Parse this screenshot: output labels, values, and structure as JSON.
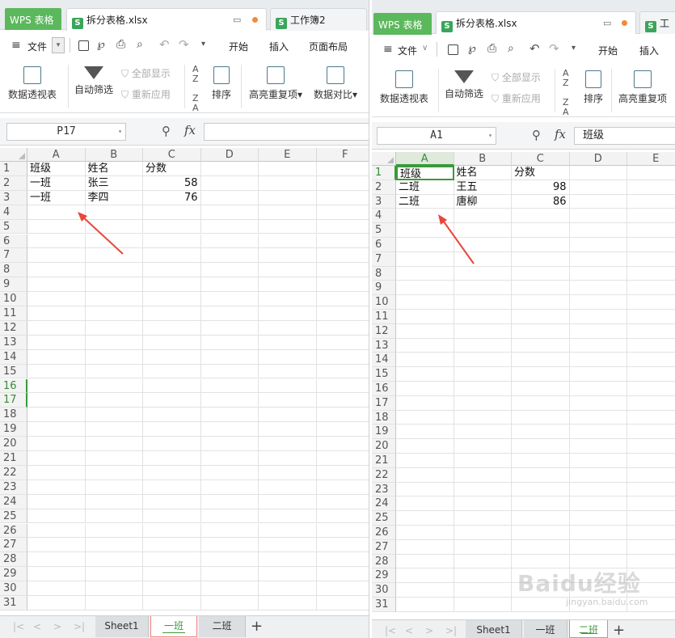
{
  "app": {
    "wps_label": "WPS 表格"
  },
  "left": {
    "file_tab": "拆分表格.xlsx",
    "other_tab": "工作簿2",
    "menu": {
      "file": "文件",
      "start": "开始",
      "insert": "插入",
      "page_layout": "页面布局"
    },
    "ribbon": {
      "pivot": "数据透视表",
      "autofilter": "自动筛选",
      "show_all": "全部显示",
      "reapply": "重新应用",
      "sort": "排序",
      "highlight_dup": "高亮重复项",
      "compare": "数据对比"
    },
    "namebox": "P17",
    "formula_value": "",
    "columns": [
      "A",
      "B",
      "C",
      "D",
      "E",
      "F"
    ],
    "rows": [
      "1",
      "2",
      "3",
      "4",
      "5",
      "6",
      "7",
      "8",
      "9",
      "10",
      "11",
      "12",
      "13",
      "14",
      "15",
      "16",
      "17",
      "18",
      "19",
      "20",
      "21",
      "22",
      "23",
      "24",
      "25",
      "26",
      "27",
      "28",
      "29",
      "30",
      "31"
    ],
    "data": [
      [
        "班级",
        "姓名",
        "分数"
      ],
      [
        "一班",
        "张三",
        "58"
      ],
      [
        "一班",
        "李四",
        "76"
      ]
    ],
    "sheets": [
      "Sheet1",
      "一班",
      "二班"
    ],
    "active_sheet": "一班",
    "nav_arrows": [
      "|<",
      "<",
      ">",
      ">|"
    ],
    "plus": "+"
  },
  "right": {
    "file_tab": "拆分表格.xlsx",
    "other_tab": "工",
    "menu": {
      "file": "文件",
      "start": "开始",
      "insert": "插入"
    },
    "ribbon": {
      "pivot": "数据透视表",
      "autofilter": "自动筛选",
      "show_all": "全部显示",
      "reapply": "重新应用",
      "sort": "排序",
      "highlight_dup": "高亮重复项"
    },
    "namebox": "A1",
    "formula_value": "班级",
    "columns": [
      "A",
      "B",
      "C",
      "D",
      "E"
    ],
    "rows": [
      "1",
      "2",
      "3",
      "4",
      "5",
      "6",
      "7",
      "8",
      "9",
      "10",
      "11",
      "12",
      "13",
      "14",
      "15",
      "16",
      "17",
      "18",
      "19",
      "20",
      "21",
      "22",
      "23",
      "24",
      "25",
      "26",
      "27",
      "28",
      "29",
      "30",
      "31"
    ],
    "data": [
      [
        "班级",
        "姓名",
        "分数"
      ],
      [
        "二班",
        "王五",
        "98"
      ],
      [
        "二班",
        "唐柳",
        "86"
      ]
    ],
    "sheets": [
      "Sheet1",
      "一班",
      "二班"
    ],
    "active_sheet": "二班",
    "nav_arrows": [
      "|<",
      "<",
      ">",
      ">|"
    ],
    "plus": "+"
  },
  "watermark": {
    "main": "Baidu经验",
    "sub": "jingyan.baidu.com"
  },
  "colors": {
    "wps_green": "#5cb85c",
    "accent_green": "#3a9a3a",
    "arrow_red": "#e8473a",
    "tab_highlight": "#f08080"
  }
}
